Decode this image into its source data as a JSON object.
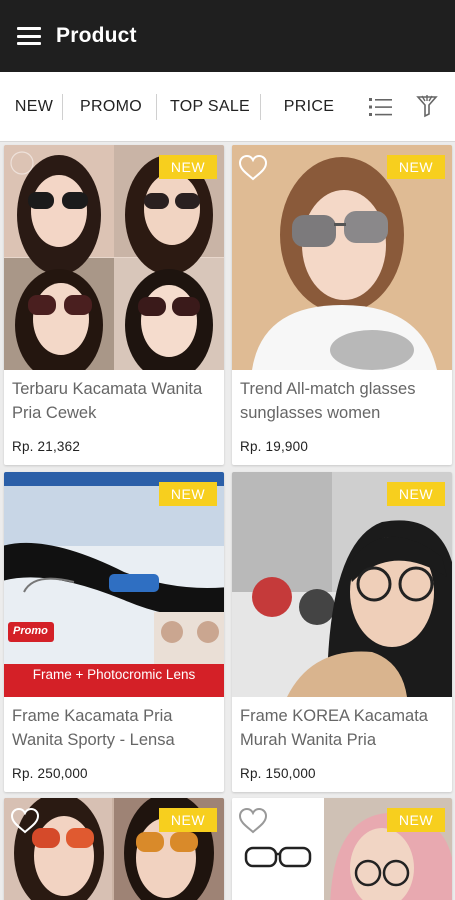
{
  "appbar": {
    "title": "Product"
  },
  "filters": {
    "new": "NEW",
    "promo": "PROMO",
    "top_sale": "TOP SALE",
    "price": "PRICE"
  },
  "icons": {
    "menu": "hamburger-menu",
    "list_view": "list-icon",
    "filter": "filter-icon",
    "favorite": "heart-outline-icon"
  },
  "colors": {
    "appbar": "#1f1f1f",
    "badge": "#f7cf1e",
    "banner_red": "#d42027"
  },
  "products": [
    {
      "title": "Terbaru Kacamata Wanita Pria Cewek",
      "price": "Rp. 21,362",
      "badge": "NEW"
    },
    {
      "title": "Trend All-match glasses sunglasses women",
      "price": "Rp. 19,900",
      "badge": "NEW"
    },
    {
      "title": "Frame Kacamata Pria Wanita Sporty - Lensa",
      "price": "Rp. 250,000",
      "badge": "NEW",
      "banner": "Frame + Photocromic Lens",
      "promo": "Promo"
    },
    {
      "title": "Frame KOREA Kacamata Murah Wanita Pria",
      "price": "Rp. 150,000",
      "badge": "NEW"
    },
    {
      "title": "",
      "price": "",
      "badge": "NEW"
    },
    {
      "title": "",
      "price": "",
      "badge": "NEW"
    }
  ]
}
